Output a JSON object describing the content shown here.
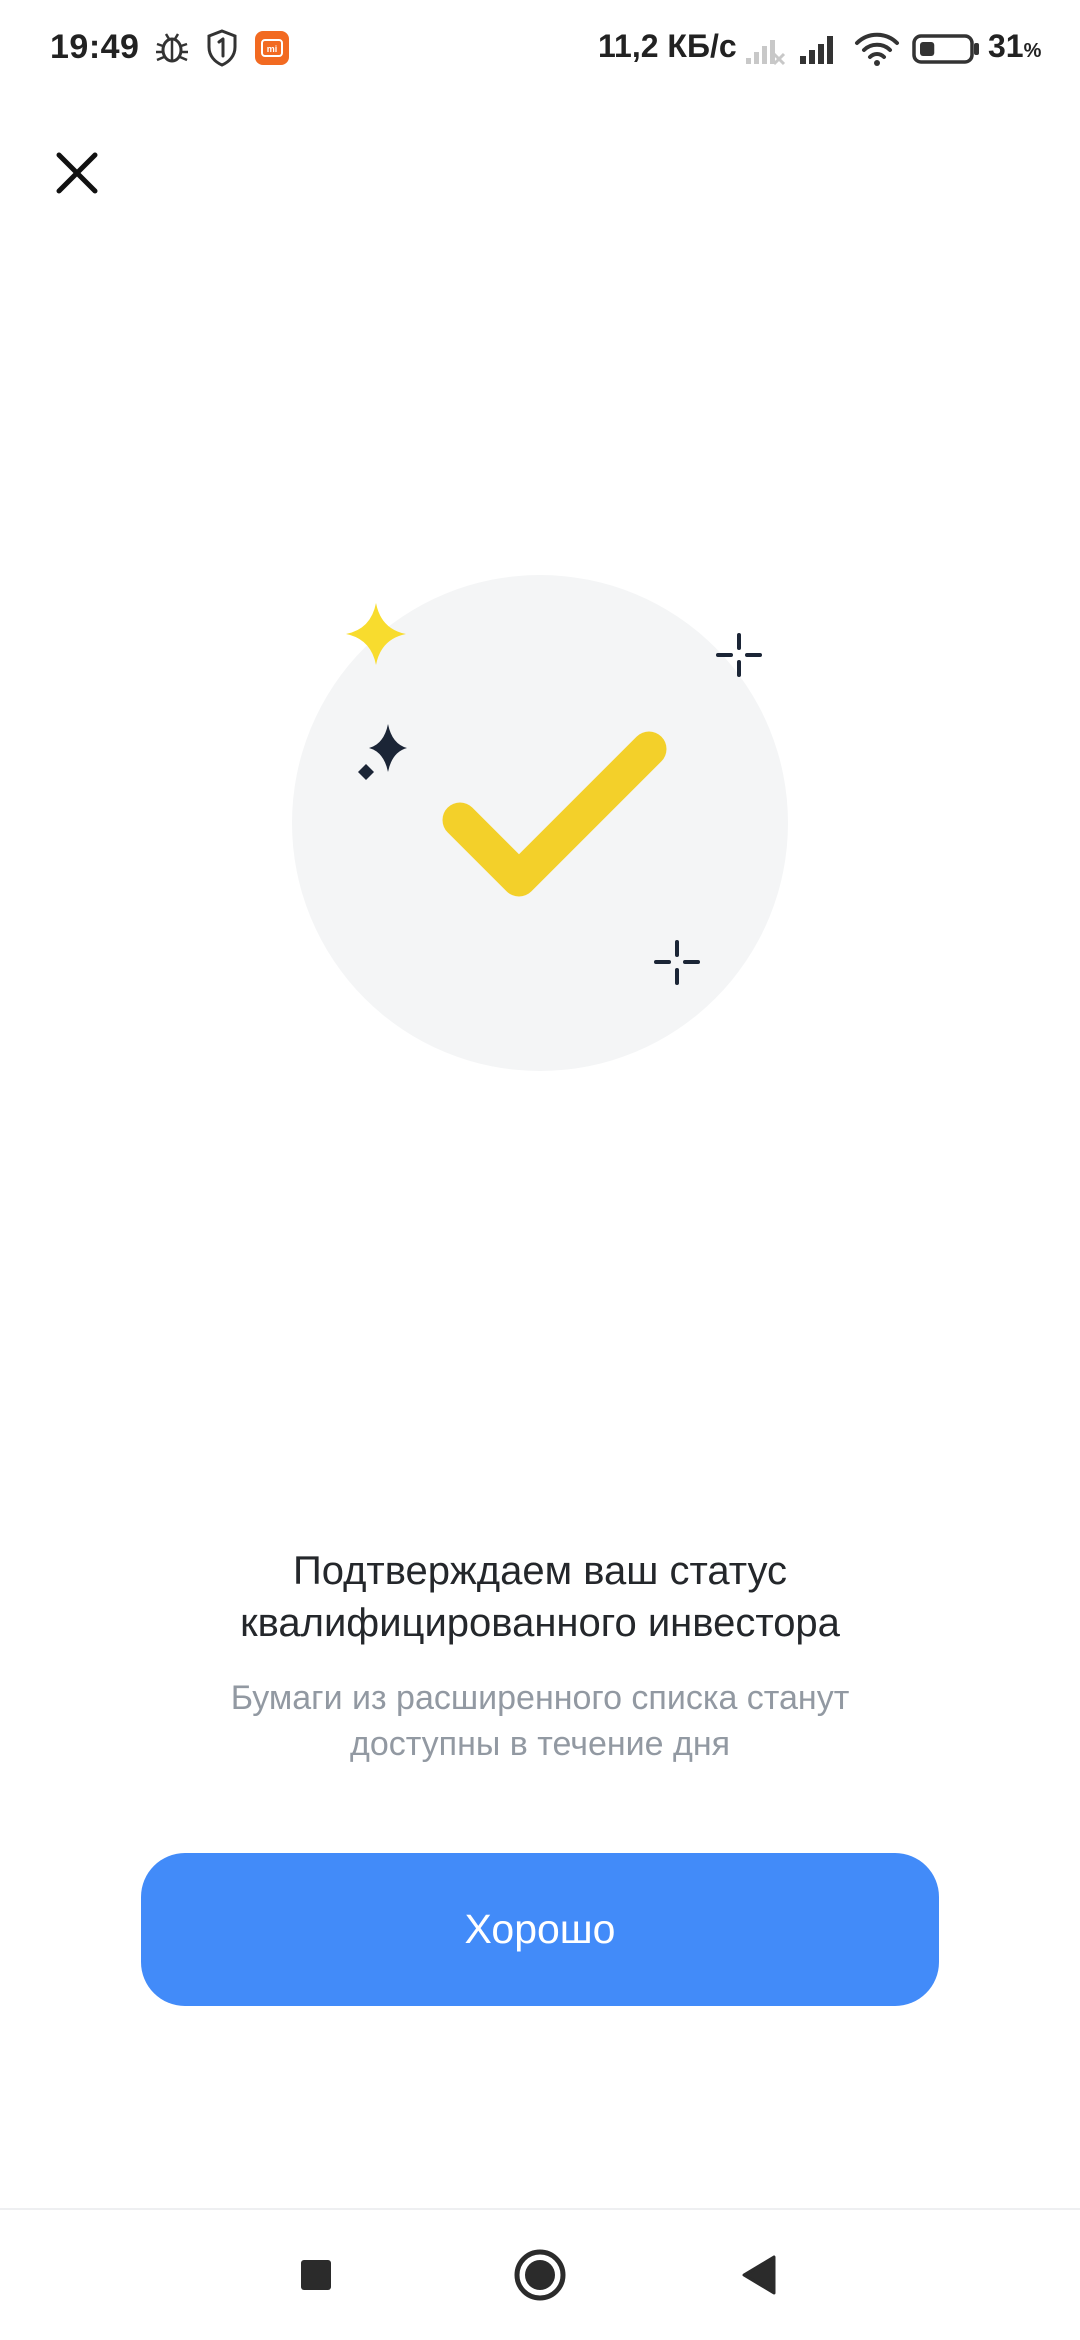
{
  "status_bar": {
    "time": "19:49",
    "net_speed": "11,2 КБ/с",
    "battery_percent": "31",
    "battery_percent_sign": "%",
    "battery_level": 0.31,
    "icons": [
      "usb-debug-icon",
      "shield-one-icon",
      "mi-app-icon",
      "no-signal-icon",
      "signal-icon",
      "wifi-icon",
      "battery-icon"
    ]
  },
  "header": {
    "close_icon": "close-icon"
  },
  "illustration": {
    "icon": "success-checkmark-icon",
    "colors": {
      "circle": "#f4f5f6",
      "check": "#f3d02a",
      "star_yellow": "#f8dc2e",
      "star_dark": "#1b2536"
    }
  },
  "content": {
    "title_line1": "Подтверждаем ваш статус",
    "title_line2": "квалифицированного инвестора",
    "subtitle_line1": "Бумаги из расширенного списка станут",
    "subtitle_line2": "доступны в течение дня"
  },
  "actions": {
    "ok_label": "Хорошо",
    "ok_color": "#428bf9"
  },
  "navigation": {
    "recents_icon": "square-recents-icon",
    "home_icon": "circle-home-icon",
    "back_icon": "triangle-back-icon"
  }
}
